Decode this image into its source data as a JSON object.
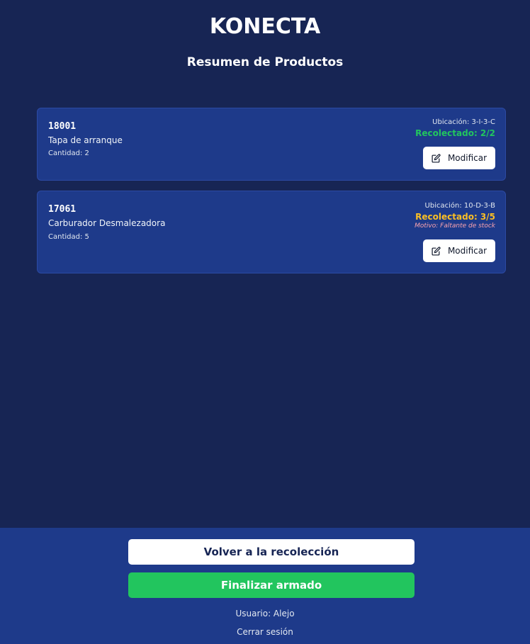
{
  "header": {
    "app_title": "KONECTA",
    "subtitle": "Resumen de Productos"
  },
  "products": [
    {
      "code": "18001",
      "name": "Tapa de arranque",
      "quantity_label": "Cantidad: 2",
      "location": "Ubicación: 3-I-3-C",
      "collected": "Recolectado: 2/2",
      "collected_color": "#22c55e",
      "reason": "",
      "modify_label": "Modificar",
      "modify_icon": "edit-icon"
    },
    {
      "code": "17061",
      "name": "Carburador Desmalezadora",
      "quantity_label": "Cantidad: 5",
      "location": "Ubicación: 10-D-3-B",
      "collected": "Recolectado: 3/5",
      "collected_color": "#fbbf24",
      "reason": "Motivo: Faltante de stock",
      "modify_label": "Modificar",
      "modify_icon": "edit-icon"
    }
  ],
  "footer": {
    "back_label": "Volver a la recolección",
    "finish_label": "Finalizar armado",
    "user_label": "Usuario: Alejo",
    "logout_label": "Cerrar sesión"
  },
  "colors": {
    "background": "#172554",
    "card": "#1e3a8a",
    "success": "#22c55e",
    "warning": "#fbbf24",
    "reason": "#fda4af"
  }
}
